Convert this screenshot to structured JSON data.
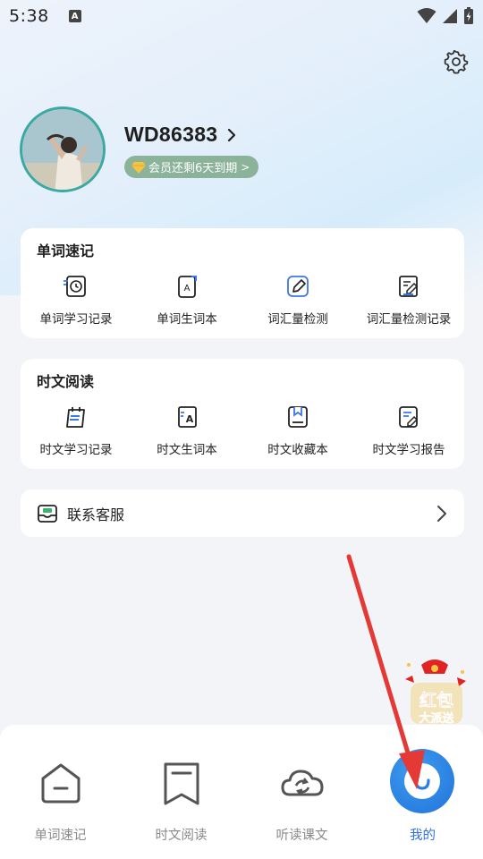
{
  "status_bar": {
    "time": "5:38",
    "notification_letter": "A"
  },
  "profile": {
    "username": "WD86383",
    "vip_text": "会员还剩6天到期",
    "vip_arrow": ">"
  },
  "word_memo": {
    "title": "单词速记",
    "items": [
      {
        "label": "单词学习记录",
        "icon": "clock-record-icon"
      },
      {
        "label": "单词生词本",
        "icon": "letter-book-icon"
      },
      {
        "label": "词汇量检测",
        "icon": "pencil-edit-icon"
      },
      {
        "label": "词汇量检测记录",
        "icon": "document-edit-icon"
      }
    ]
  },
  "reading": {
    "title": "时文阅读",
    "items": [
      {
        "label": "时文学习记录",
        "icon": "calendar-list-icon"
      },
      {
        "label": "时文生词本",
        "icon": "letter-a-book-icon"
      },
      {
        "label": "时文收藏本",
        "icon": "bookmark-book-icon"
      },
      {
        "label": "时文学习报告",
        "icon": "report-edit-icon"
      }
    ]
  },
  "service": {
    "label": "联系客服"
  },
  "promo": {
    "line1": "红包",
    "line2": "大派送"
  },
  "bottom_nav": {
    "items": [
      {
        "label": "单词速记",
        "icon": "home-icon"
      },
      {
        "label": "时文阅读",
        "icon": "bookmark-icon"
      },
      {
        "label": "听读课文",
        "icon": "cloud-sync-icon"
      },
      {
        "label": "我的",
        "icon": "me-icon",
        "active": true
      }
    ]
  },
  "colors": {
    "accent": "#2f6fe0",
    "vip_badge": "#8bb39a",
    "icon_blue": "#3a78e6",
    "arrow_red": "#e53935"
  }
}
